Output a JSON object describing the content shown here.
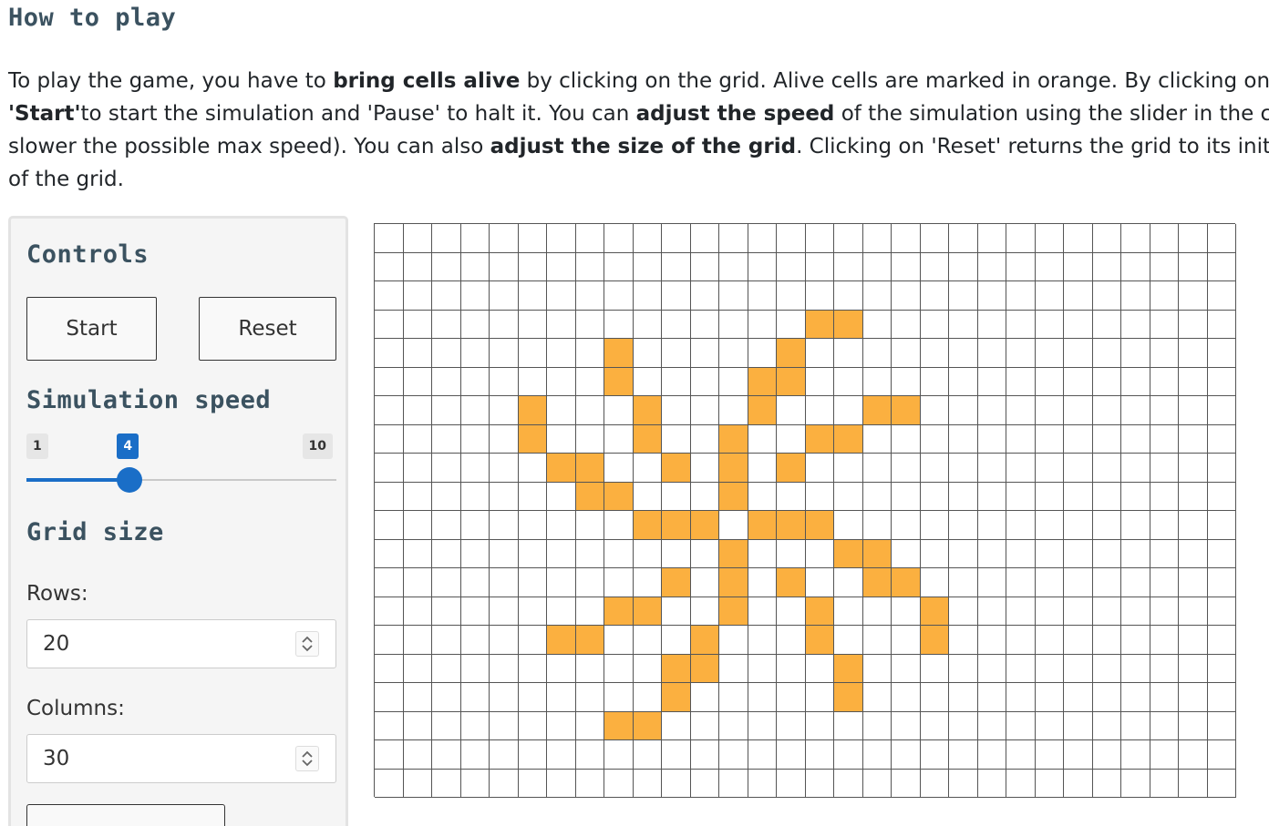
{
  "page": {
    "title": "How to play",
    "intro_lines": [
      [
        {
          "t": "To play the game, you have to ",
          "b": false
        },
        {
          "t": "bring cells alive",
          "b": true
        },
        {
          "t": " by clicking on the grid. Alive cells are marked in orange. By clicking on the sar",
          "b": false
        }
      ],
      [
        {
          "t": "'Start'",
          "b": true
        },
        {
          "t": "to start the simulation and 'Pause' to halt it. You can ",
          "b": false
        },
        {
          "t": "adjust the speed",
          "b": true
        },
        {
          "t": " of the simulation using the slider in the control",
          "b": false
        }
      ],
      [
        {
          "t": "slower the possible max speed). You can also ",
          "b": false
        },
        {
          "t": "adjust the size of the grid",
          "b": true
        },
        {
          "t": ". Clicking on 'Reset' returns the grid to its initial blar",
          "b": false
        }
      ],
      [
        {
          "t": "of the grid.",
          "b": false
        }
      ]
    ]
  },
  "controls": {
    "heading": "Controls",
    "start_label": "Start",
    "reset_label": "Reset",
    "speed_heading": "Simulation speed",
    "speed": {
      "min": 1,
      "max": 10,
      "value": 4
    },
    "grid_heading": "Grid size",
    "rows_label": "Rows:",
    "rows_value": "20",
    "columns_label": "Columns:",
    "columns_value": "30"
  },
  "grid": {
    "rows": 20,
    "cols": 30,
    "alive_color": "#fbb040",
    "alive": [
      [
        3,
        15
      ],
      [
        3,
        16
      ],
      [
        4,
        8
      ],
      [
        4,
        14
      ],
      [
        5,
        8
      ],
      [
        5,
        13
      ],
      [
        5,
        14
      ],
      [
        6,
        5
      ],
      [
        6,
        9
      ],
      [
        6,
        13
      ],
      [
        6,
        17
      ],
      [
        6,
        18
      ],
      [
        7,
        5
      ],
      [
        7,
        9
      ],
      [
        7,
        12
      ],
      [
        7,
        15
      ],
      [
        7,
        16
      ],
      [
        8,
        6
      ],
      [
        8,
        7
      ],
      [
        8,
        10
      ],
      [
        8,
        12
      ],
      [
        8,
        14
      ],
      [
        9,
        7
      ],
      [
        9,
        8
      ],
      [
        9,
        12
      ],
      [
        10,
        9
      ],
      [
        10,
        10
      ],
      [
        10,
        11
      ],
      [
        10,
        13
      ],
      [
        10,
        14
      ],
      [
        10,
        15
      ],
      [
        11,
        12
      ],
      [
        11,
        16
      ],
      [
        11,
        17
      ],
      [
        12,
        10
      ],
      [
        12,
        12
      ],
      [
        12,
        14
      ],
      [
        12,
        17
      ],
      [
        12,
        18
      ],
      [
        13,
        8
      ],
      [
        13,
        9
      ],
      [
        13,
        12
      ],
      [
        13,
        15
      ],
      [
        13,
        19
      ],
      [
        14,
        6
      ],
      [
        14,
        7
      ],
      [
        14,
        11
      ],
      [
        14,
        15
      ],
      [
        14,
        19
      ],
      [
        15,
        10
      ],
      [
        15,
        11
      ],
      [
        15,
        16
      ],
      [
        16,
        10
      ],
      [
        16,
        16
      ],
      [
        17,
        8
      ],
      [
        17,
        9
      ]
    ]
  }
}
